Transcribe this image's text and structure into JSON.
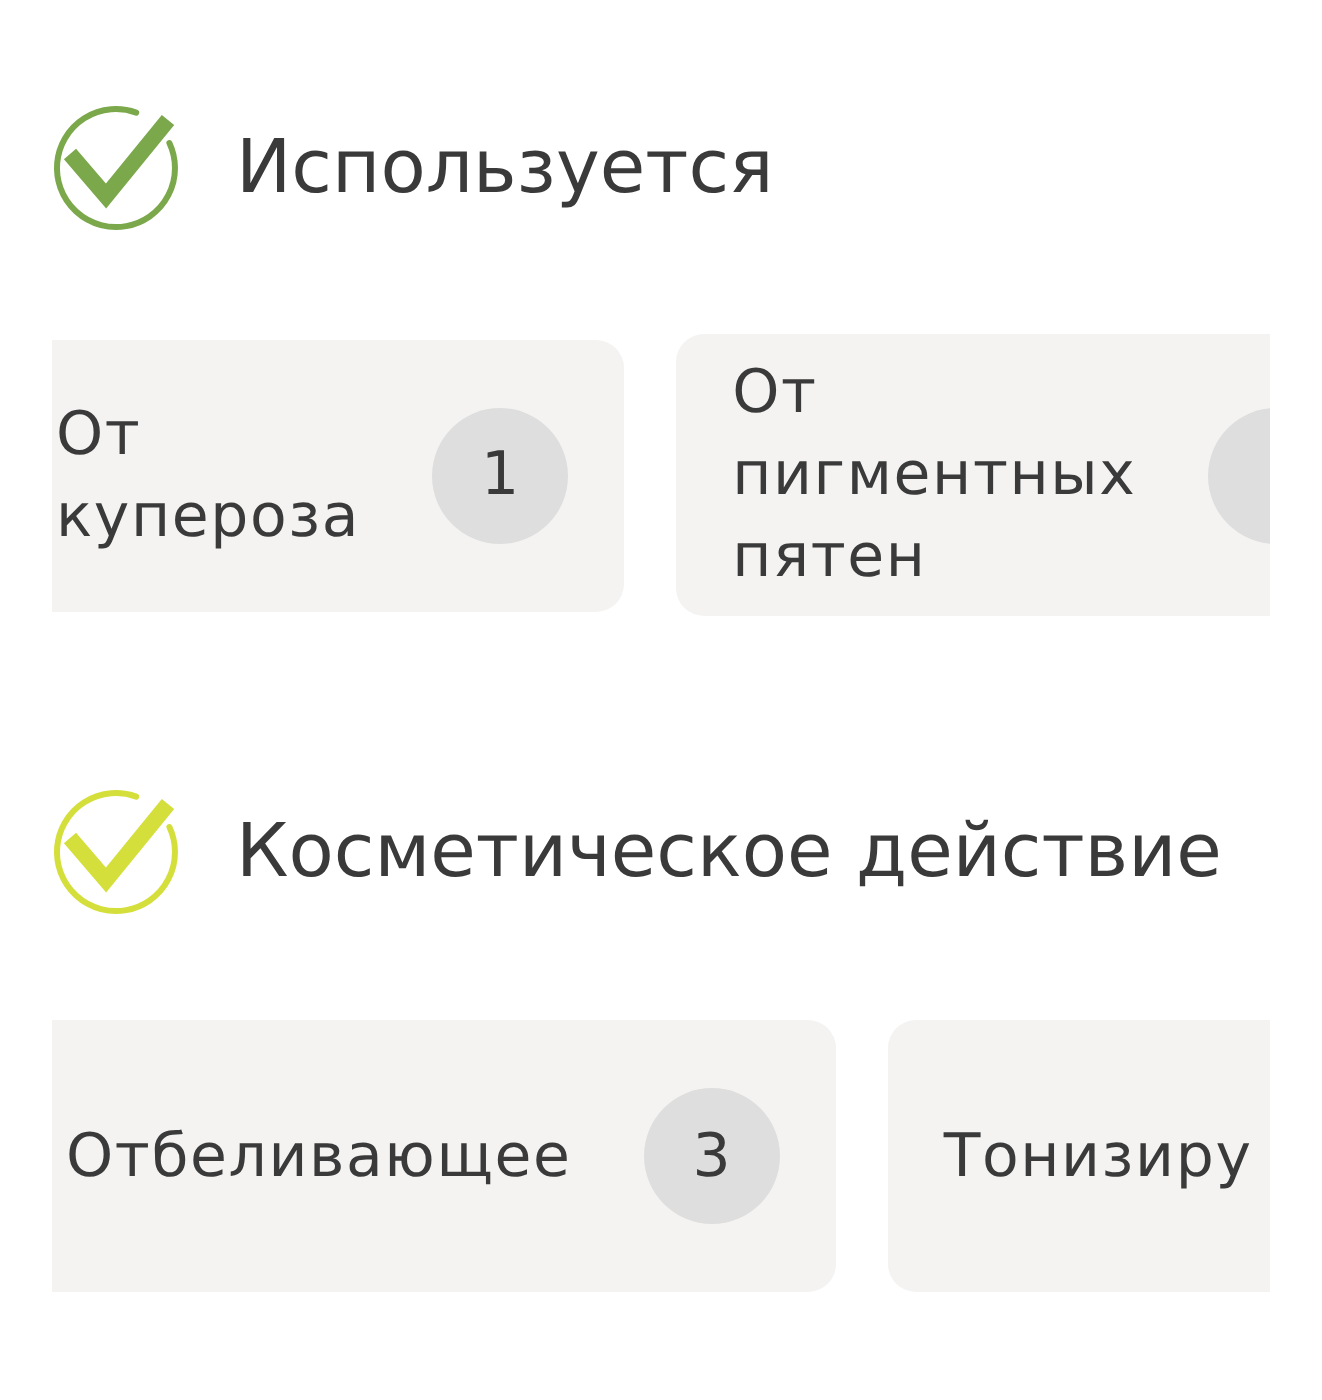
{
  "sections": [
    {
      "title": "Используется",
      "color": "#7ba84b",
      "items": [
        {
          "label": "От купероза",
          "count": "1"
        },
        {
          "label": "От пигментных пятен",
          "badge": true
        }
      ]
    },
    {
      "title": "Косметическое действие",
      "color": "#d5df3b",
      "items": [
        {
          "label": "Отбеливающее",
          "count": "3"
        },
        {
          "label": "Тонизиру"
        }
      ]
    }
  ]
}
